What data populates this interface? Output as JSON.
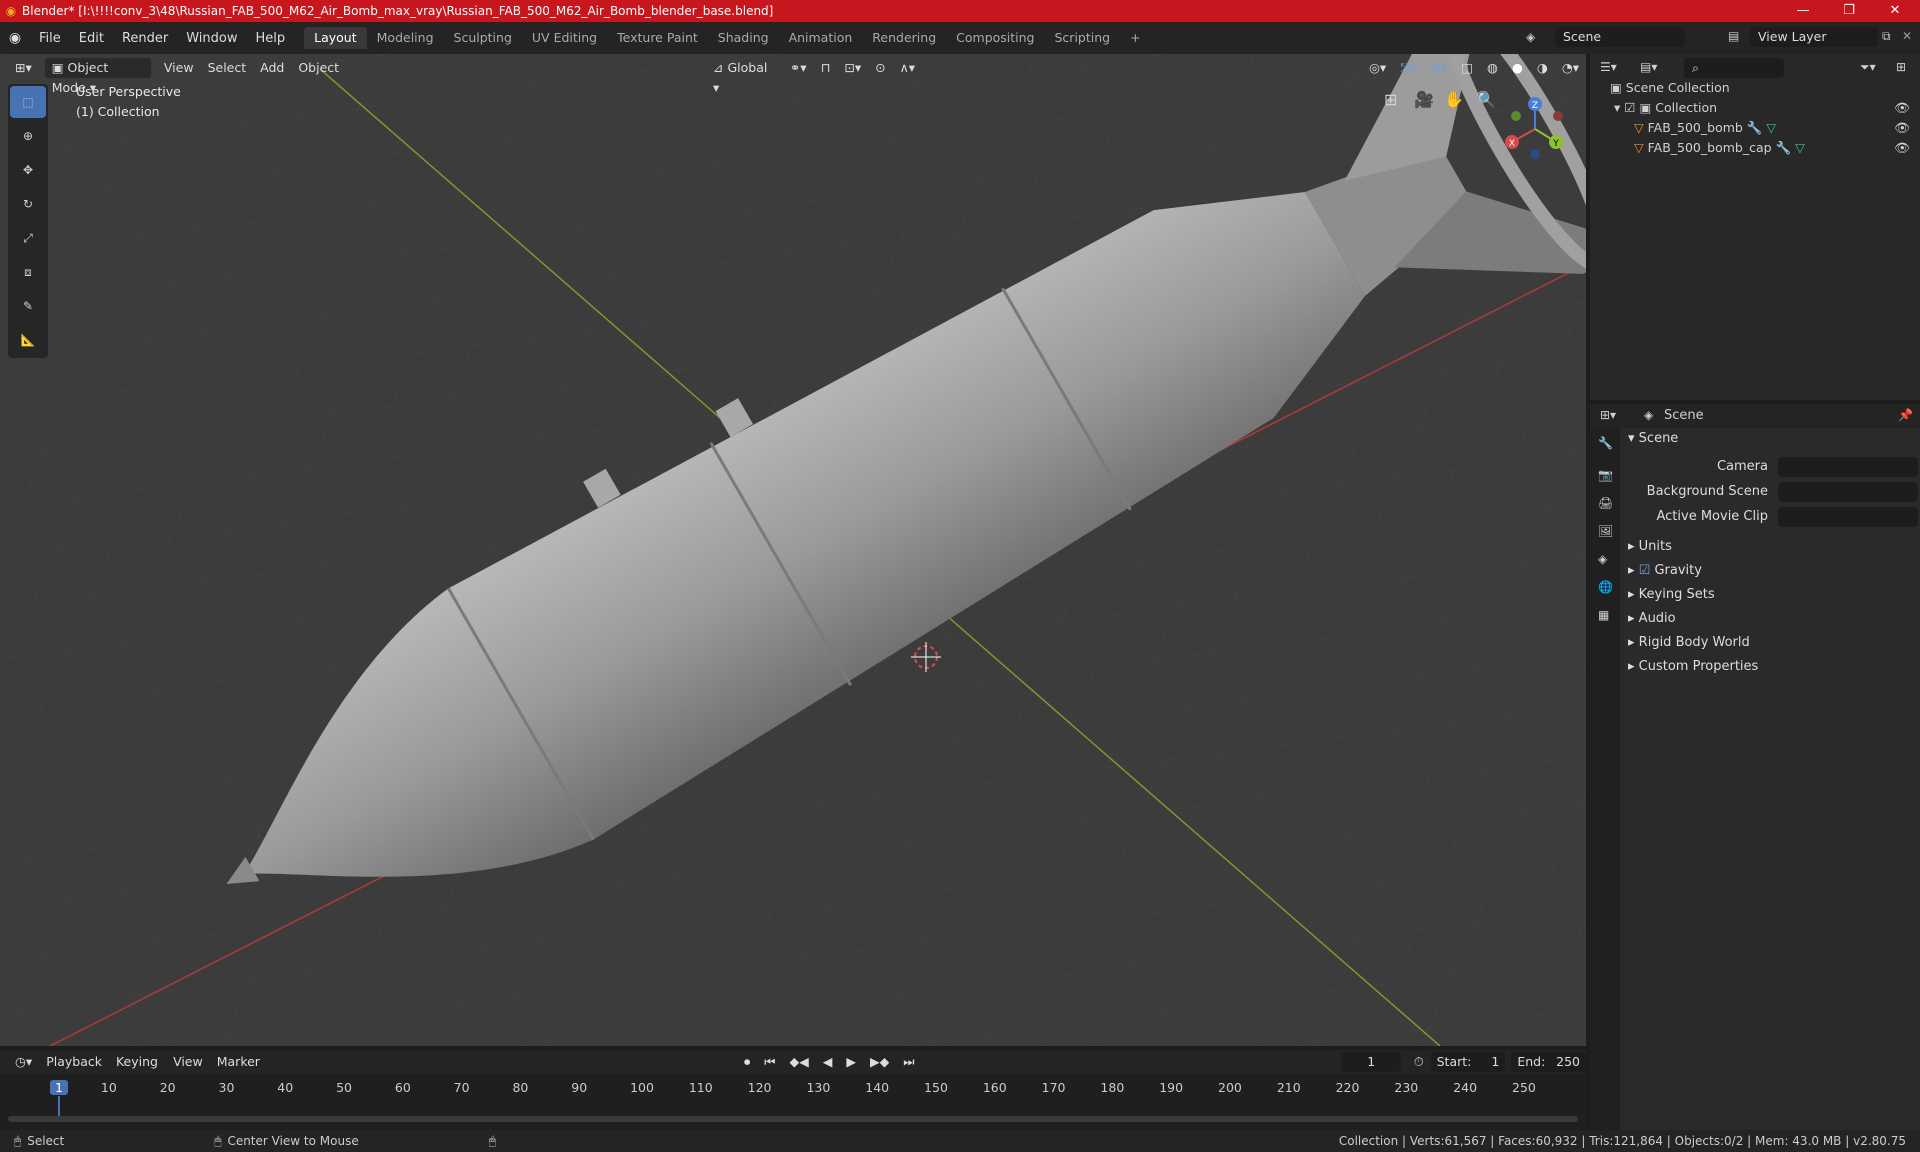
{
  "window": {
    "title": "Blender* [I:\\!!!!conv_3\\48\\Russian_FAB_500_M62_Air_Bomb_max_vray\\Russian_FAB_500_M62_Air_Bomb_blender_base.blend]",
    "minimize": "—",
    "maximize": "❐",
    "close": "✕"
  },
  "menus": [
    "File",
    "Edit",
    "Render",
    "Window",
    "Help"
  ],
  "workspaces": [
    "Layout",
    "Modeling",
    "Sculpting",
    "UV Editing",
    "Texture Paint",
    "Shading",
    "Animation",
    "Rendering",
    "Compositing",
    "Scripting"
  ],
  "add_tab": "+",
  "scene_field": "Scene",
  "viewlayer_field": "View Layer",
  "viewport": {
    "mode": "Object Mode",
    "menus": [
      "View",
      "Select",
      "Add",
      "Object"
    ],
    "transform": "Global",
    "perspective": "User Perspective",
    "collection": "(1) Collection",
    "gizmo": {
      "x": "X",
      "y": "Y",
      "z": "Z"
    }
  },
  "outliner": {
    "search_placeholder": "",
    "root": "Scene Collection",
    "collection": "Collection",
    "objects": [
      "FAB_500_bomb",
      "FAB_500_bomb_cap"
    ]
  },
  "properties": {
    "header": "Scene",
    "section": "Scene",
    "fields": [
      {
        "label": "Camera",
        "value": ""
      },
      {
        "label": "Background Scene",
        "value": ""
      },
      {
        "label": "Active Movie Clip",
        "value": ""
      }
    ],
    "panels": [
      "Units",
      "Gravity",
      "Keying Sets",
      "Audio",
      "Rigid Body World",
      "Custom Properties"
    ]
  },
  "timeline": {
    "menus": [
      "Playback",
      "Keying",
      "View",
      "Marker"
    ],
    "current_frame": "1",
    "start_label": "Start:",
    "start": "1",
    "end_label": "End:",
    "end": "250",
    "ticks": [
      "1",
      "10",
      "20",
      "30",
      "40",
      "50",
      "60",
      "70",
      "80",
      "90",
      "100",
      "110",
      "120",
      "130",
      "140",
      "150",
      "160",
      "170",
      "180",
      "190",
      "200",
      "210",
      "220",
      "230",
      "240",
      "250"
    ]
  },
  "status": {
    "left": "Select",
    "middle": "Center View to Mouse",
    "right": "Collection | Verts:61,567 | Faces:60,932 | Tris:121,864 | Objects:0/2 | Mem: 43.0 MB | v2.80.75"
  }
}
